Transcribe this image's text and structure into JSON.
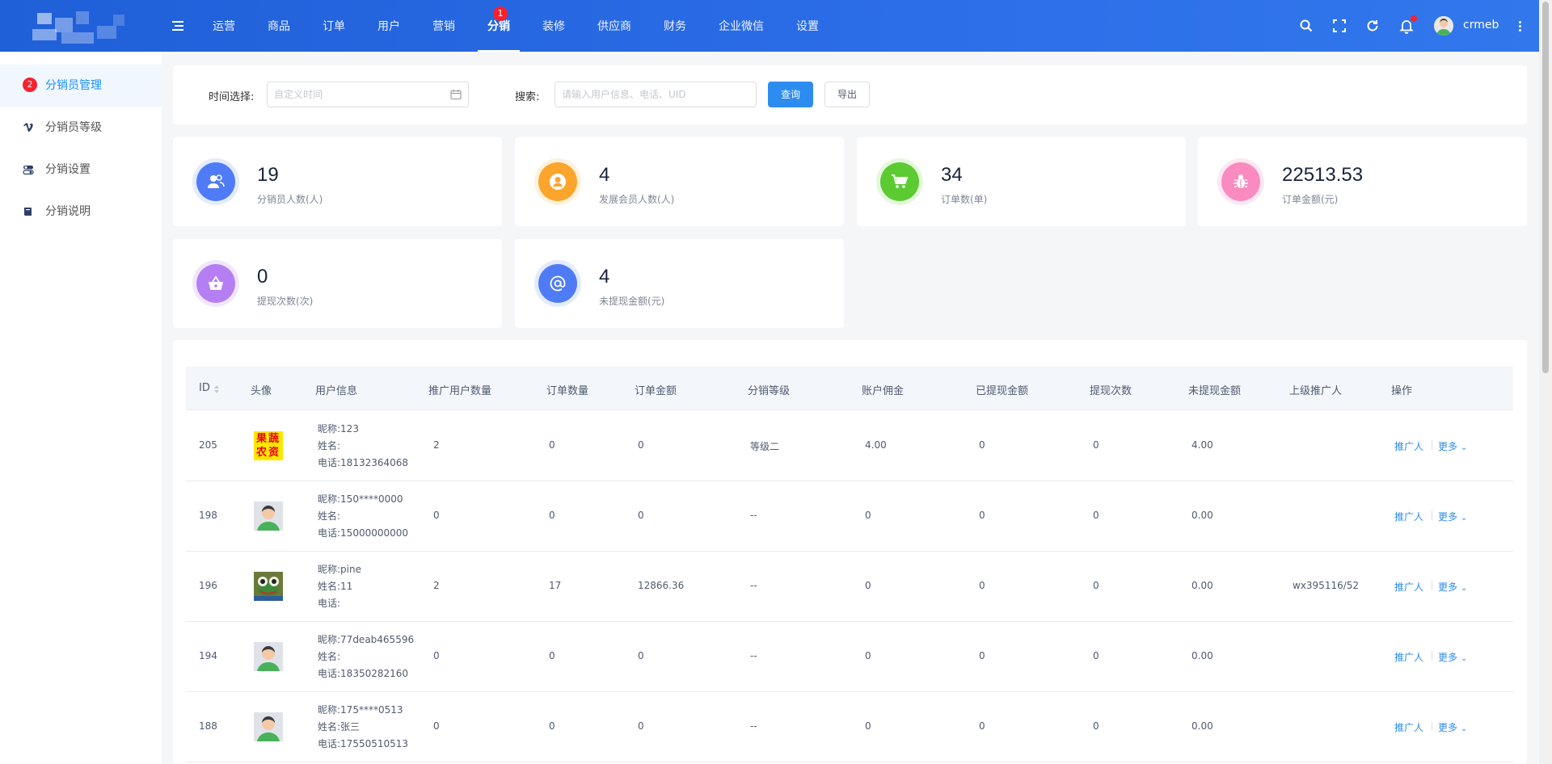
{
  "header": {
    "nav": [
      {
        "label": "运营"
      },
      {
        "label": "商品"
      },
      {
        "label": "订单"
      },
      {
        "label": "用户"
      },
      {
        "label": "营销"
      },
      {
        "label": "分销",
        "badge": "1",
        "active": true
      },
      {
        "label": "装修"
      },
      {
        "label": "供应商"
      },
      {
        "label": "财务"
      },
      {
        "label": "企业微信"
      },
      {
        "label": "设置"
      }
    ],
    "user_name": "crmeb"
  },
  "sidebar": {
    "items": [
      {
        "label": "分销员管理",
        "badge": "2",
        "active": true,
        "icon": "badge"
      },
      {
        "label": "分销员等级",
        "icon": "vimeo-icon"
      },
      {
        "label": "分销设置",
        "icon": "toggle-icon"
      },
      {
        "label": "分销说明",
        "icon": "book-icon"
      }
    ]
  },
  "filter": {
    "time_label": "时间选择:",
    "time_placeholder": "自定义时间",
    "search_label": "搜索:",
    "search_placeholder": "请输入用户信息、电话、UID",
    "query_button": "查询",
    "export_button": "导出"
  },
  "stats": [
    {
      "value": "19",
      "label": "分销员人数(人)",
      "color": "#4f7cf6",
      "ring": "#e4ebfd",
      "icon": "users-icon"
    },
    {
      "value": "4",
      "label": "发展会员人数(人)",
      "color": "#fba52d",
      "ring": "#fff1dc",
      "icon": "user-circle-icon"
    },
    {
      "value": "34",
      "label": "订单数(单)",
      "color": "#5bcb31",
      "ring": "#e5f7dd",
      "icon": "cart-icon"
    },
    {
      "value": "22513.53",
      "label": "订单金额(元)",
      "color": "#f98bc0",
      "ring": "#fde8f2",
      "icon": "bug-icon"
    },
    {
      "value": "0",
      "label": "提现次数(次)",
      "color": "#b57ff3",
      "ring": "#f1e7fd",
      "icon": "basket-icon"
    },
    {
      "value": "4",
      "label": "未提现金额(元)",
      "color": "#4f7cf6",
      "ring": "#e4ebfd",
      "icon": "at-icon"
    }
  ],
  "table": {
    "columns": [
      "ID",
      "头像",
      "用户信息",
      "推广用户数量",
      "订单数量",
      "订单金额",
      "分销等级",
      "账户佣金",
      "已提现金额",
      "提现次数",
      "未提现金额",
      "上级推广人",
      "操作"
    ],
    "rows": [
      {
        "id": "205",
        "avatar": "fruit-veg-logo",
        "nick": "昵称:123",
        "name": "姓名:",
        "phone": "电话:18132364068",
        "promo": "2",
        "orders": "0",
        "amount": "0",
        "level": "等级二",
        "commission": "4.00",
        "withdrawn": "0",
        "times": "0",
        "pending": "4.00",
        "upline": ""
      },
      {
        "id": "198",
        "avatar": "default-avatar",
        "nick": "昵称:150****0000",
        "name": "姓名:",
        "phone": "电话:15000000000",
        "promo": "0",
        "orders": "0",
        "amount": "0",
        "level": "--",
        "commission": "0",
        "withdrawn": "0",
        "times": "0",
        "pending": "0.00",
        "upline": ""
      },
      {
        "id": "196",
        "avatar": "frog-avatar",
        "nick": "昵称:pine",
        "name": "姓名:11",
        "phone": "电话:",
        "promo": "2",
        "orders": "17",
        "amount": "12866.36",
        "level": "--",
        "commission": "0",
        "withdrawn": "0",
        "times": "0",
        "pending": "0.00",
        "upline": "wx395116/52"
      },
      {
        "id": "194",
        "avatar": "default-avatar",
        "nick": "昵称:77deab465596",
        "name": "姓名:",
        "phone": "电话:18350282160",
        "promo": "0",
        "orders": "0",
        "amount": "0",
        "level": "--",
        "commission": "0",
        "withdrawn": "0",
        "times": "0",
        "pending": "0.00",
        "upline": ""
      },
      {
        "id": "188",
        "avatar": "default-avatar",
        "nick": "昵称:175****0513",
        "name": "姓名:张三",
        "phone": "电话:17550510513",
        "promo": "0",
        "orders": "0",
        "amount": "0",
        "level": "--",
        "commission": "0",
        "withdrawn": "0",
        "times": "0",
        "pending": "0.00",
        "upline": ""
      }
    ],
    "action_promoter": "推广人",
    "action_more": "更多",
    "logo_text": "果蔬农资"
  }
}
